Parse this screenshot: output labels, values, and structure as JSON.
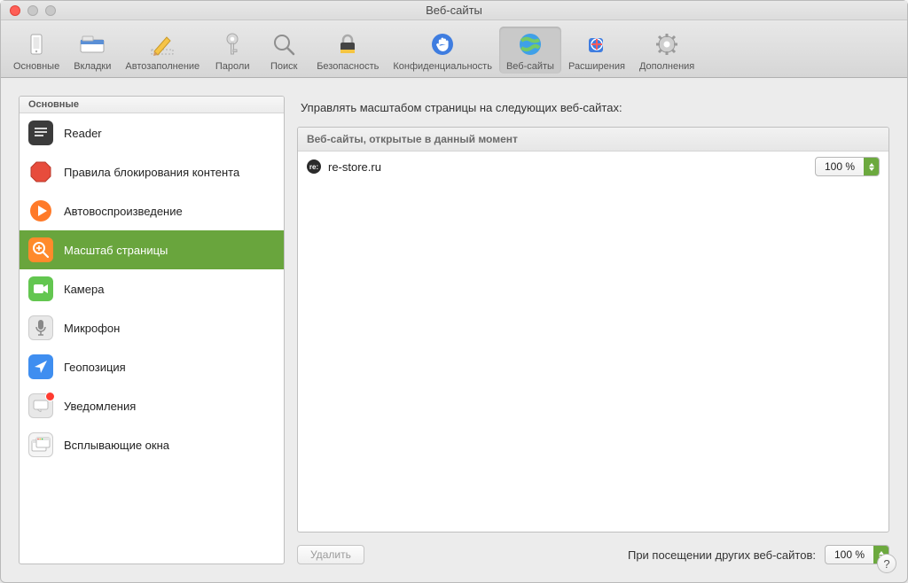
{
  "window": {
    "title": "Веб-сайты"
  },
  "toolbar": {
    "items": [
      {
        "label": "Основные"
      },
      {
        "label": "Вкладки"
      },
      {
        "label": "Автозаполнение"
      },
      {
        "label": "Пароли"
      },
      {
        "label": "Поиск"
      },
      {
        "label": "Безопасность"
      },
      {
        "label": "Конфиденциальность"
      },
      {
        "label": "Веб-сайты"
      },
      {
        "label": "Расширения"
      },
      {
        "label": "Дополнения"
      }
    ],
    "selected_index": 7
  },
  "sidebar": {
    "header": "Основные",
    "items": [
      {
        "label": "Reader"
      },
      {
        "label": "Правила блокирования контента"
      },
      {
        "label": "Автовоспроизведение"
      },
      {
        "label": "Масштаб страницы"
      },
      {
        "label": "Камера"
      },
      {
        "label": "Микрофон"
      },
      {
        "label": "Геопозиция"
      },
      {
        "label": "Уведомления"
      },
      {
        "label": "Всплывающие окна"
      }
    ],
    "selected_index": 3
  },
  "main": {
    "heading": "Управлять масштабом страницы на следующих веб-сайтах:",
    "list_header": "Веб-сайты, открытые в данный момент",
    "sites": [
      {
        "favicon_text": "re:",
        "domain": "re-store.ru",
        "zoom": "100 %"
      }
    ],
    "delete_label": "Удалить",
    "others_label": "При посещении других веб-сайтов:",
    "others_zoom": "100 %"
  },
  "help": {
    "label": "?"
  }
}
